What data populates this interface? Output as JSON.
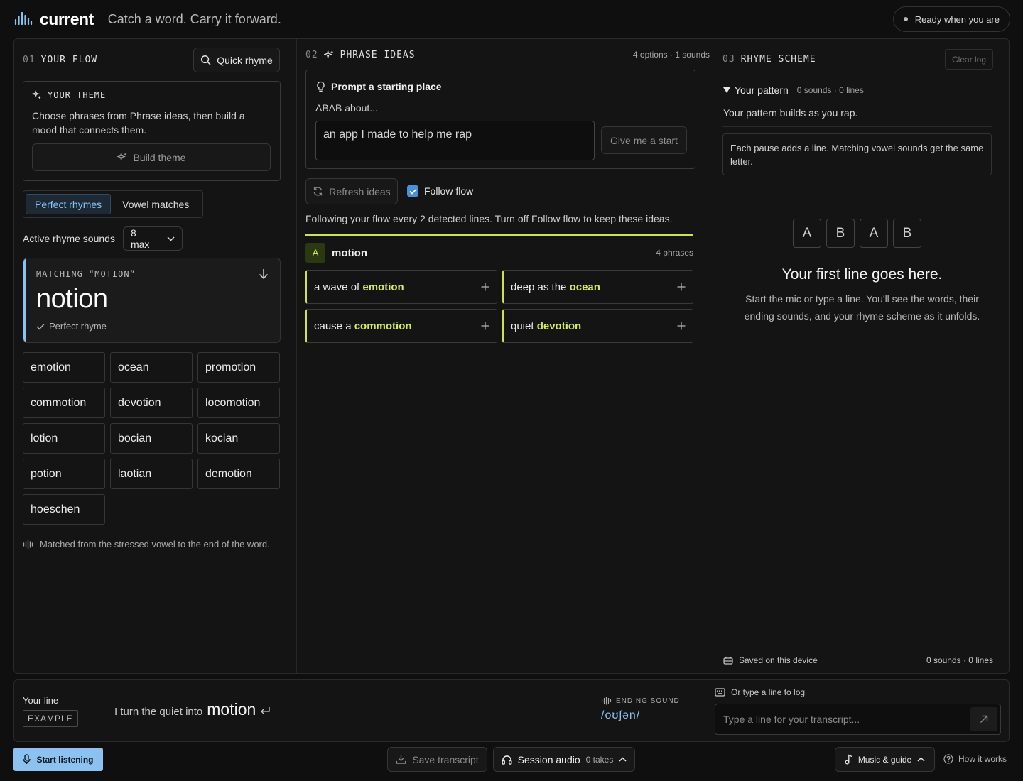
{
  "header": {
    "brand": "current",
    "tagline": "Catch a word. Carry it forward.",
    "status": "Ready when you are"
  },
  "flow": {
    "num": "01",
    "title": "YOUR FLOW",
    "quick_rhyme": "Quick rhyme",
    "theme": {
      "title": "YOUR THEME",
      "description": "Choose phrases from Phrase ideas, then build a mood that connects them.",
      "build_label": "Build theme"
    },
    "tabs": [
      "Perfect rhymes",
      "Vowel matches"
    ],
    "active_tab": "Perfect rhymes",
    "active_sounds_label": "Active rhyme sounds",
    "active_sounds_value": "8 max",
    "match": {
      "label": "MATCHING “MOTION”",
      "word": "notion",
      "type": "Perfect rhyme"
    },
    "words": [
      "emotion",
      "ocean",
      "promotion",
      "commotion",
      "devotion",
      "locomotion",
      "lotion",
      "bocian",
      "kocian",
      "potion",
      "laotian",
      "demotion",
      "hoeschen"
    ],
    "note": "Matched from the stressed vowel to the end of the word."
  },
  "phrases": {
    "num": "02",
    "title": "PHRASE IDEAS",
    "count": "4 options · 1 sounds",
    "prompt_title": "Prompt a starting place",
    "prompt_sub": "ABAB about...",
    "prompt_value": "an app I made to help me rap",
    "give_label": "Give me a start",
    "refresh_label": "Refresh ideas",
    "follow_label": "Follow flow",
    "follow_note": "Following your flow every 2 detected lines. Turn off Follow flow to keep these ideas.",
    "group": {
      "letter": "A",
      "word": "motion",
      "count": "4 phrases",
      "items": [
        {
          "pre": "a wave of ",
          "hl": "emotion"
        },
        {
          "pre": "deep as the ",
          "hl": "ocean"
        },
        {
          "pre": "cause a ",
          "hl": "commotion"
        },
        {
          "pre": "quiet ",
          "hl": "devotion"
        }
      ]
    }
  },
  "scheme": {
    "num": "03",
    "title": "RHYME SCHEME",
    "clear_label": "Clear log",
    "pattern_label": "Your pattern",
    "pattern_meta": "0 sounds · 0 lines",
    "pattern_sub": "Your pattern builds as you rap.",
    "info": "Each pause adds a line. Matching vowel sounds get the same letter.",
    "letters": [
      "A",
      "B",
      "A",
      "B"
    ],
    "empty_title": "Your first line goes here.",
    "empty_sub": "Start the mic or type a line. You'll see the words, their ending sounds, and your rhyme scheme as it unfolds.",
    "saved": "Saved on this device",
    "saved_meta": "0 sounds · 0 lines"
  },
  "line": {
    "label": "Your line",
    "example": "EXAMPLE",
    "text": "I turn the quiet into",
    "end_word": "motion",
    "ending_label": "ENDING SOUND",
    "ending_value": "/oʊʃən/",
    "type_label": "Or type a line to log",
    "type_placeholder": "Type a line for your transcript..."
  },
  "footer": {
    "start": "Start listening",
    "save": "Save transcript",
    "session": "Session audio",
    "takes": "0 takes",
    "music": "Music & guide",
    "how": "How it works"
  },
  "colors": {
    "accent_blue": "#8cc2ef",
    "accent_lime": "#c8e64c"
  }
}
